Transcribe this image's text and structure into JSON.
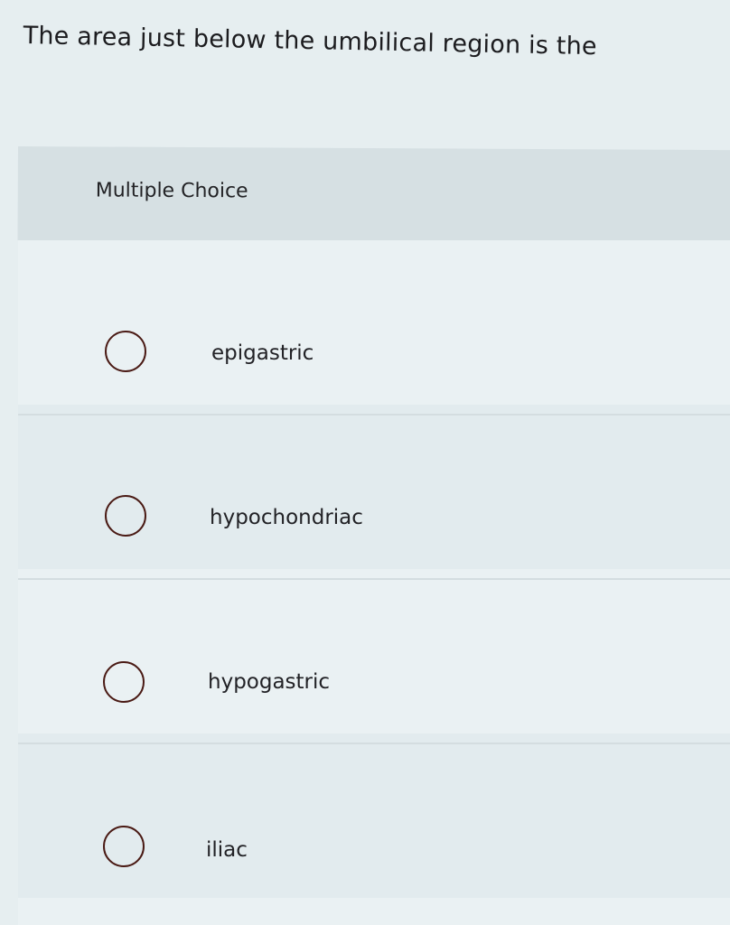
{
  "question": {
    "text": "The area just below the umbilical region is the"
  },
  "multiple_choice": {
    "label": "Multiple Choice",
    "options": [
      {
        "label": "epigastric",
        "selected": false
      },
      {
        "label": "hypochondriac",
        "selected": false
      },
      {
        "label": "hypogastric",
        "selected": false
      },
      {
        "label": "iliac",
        "selected": false
      }
    ]
  }
}
